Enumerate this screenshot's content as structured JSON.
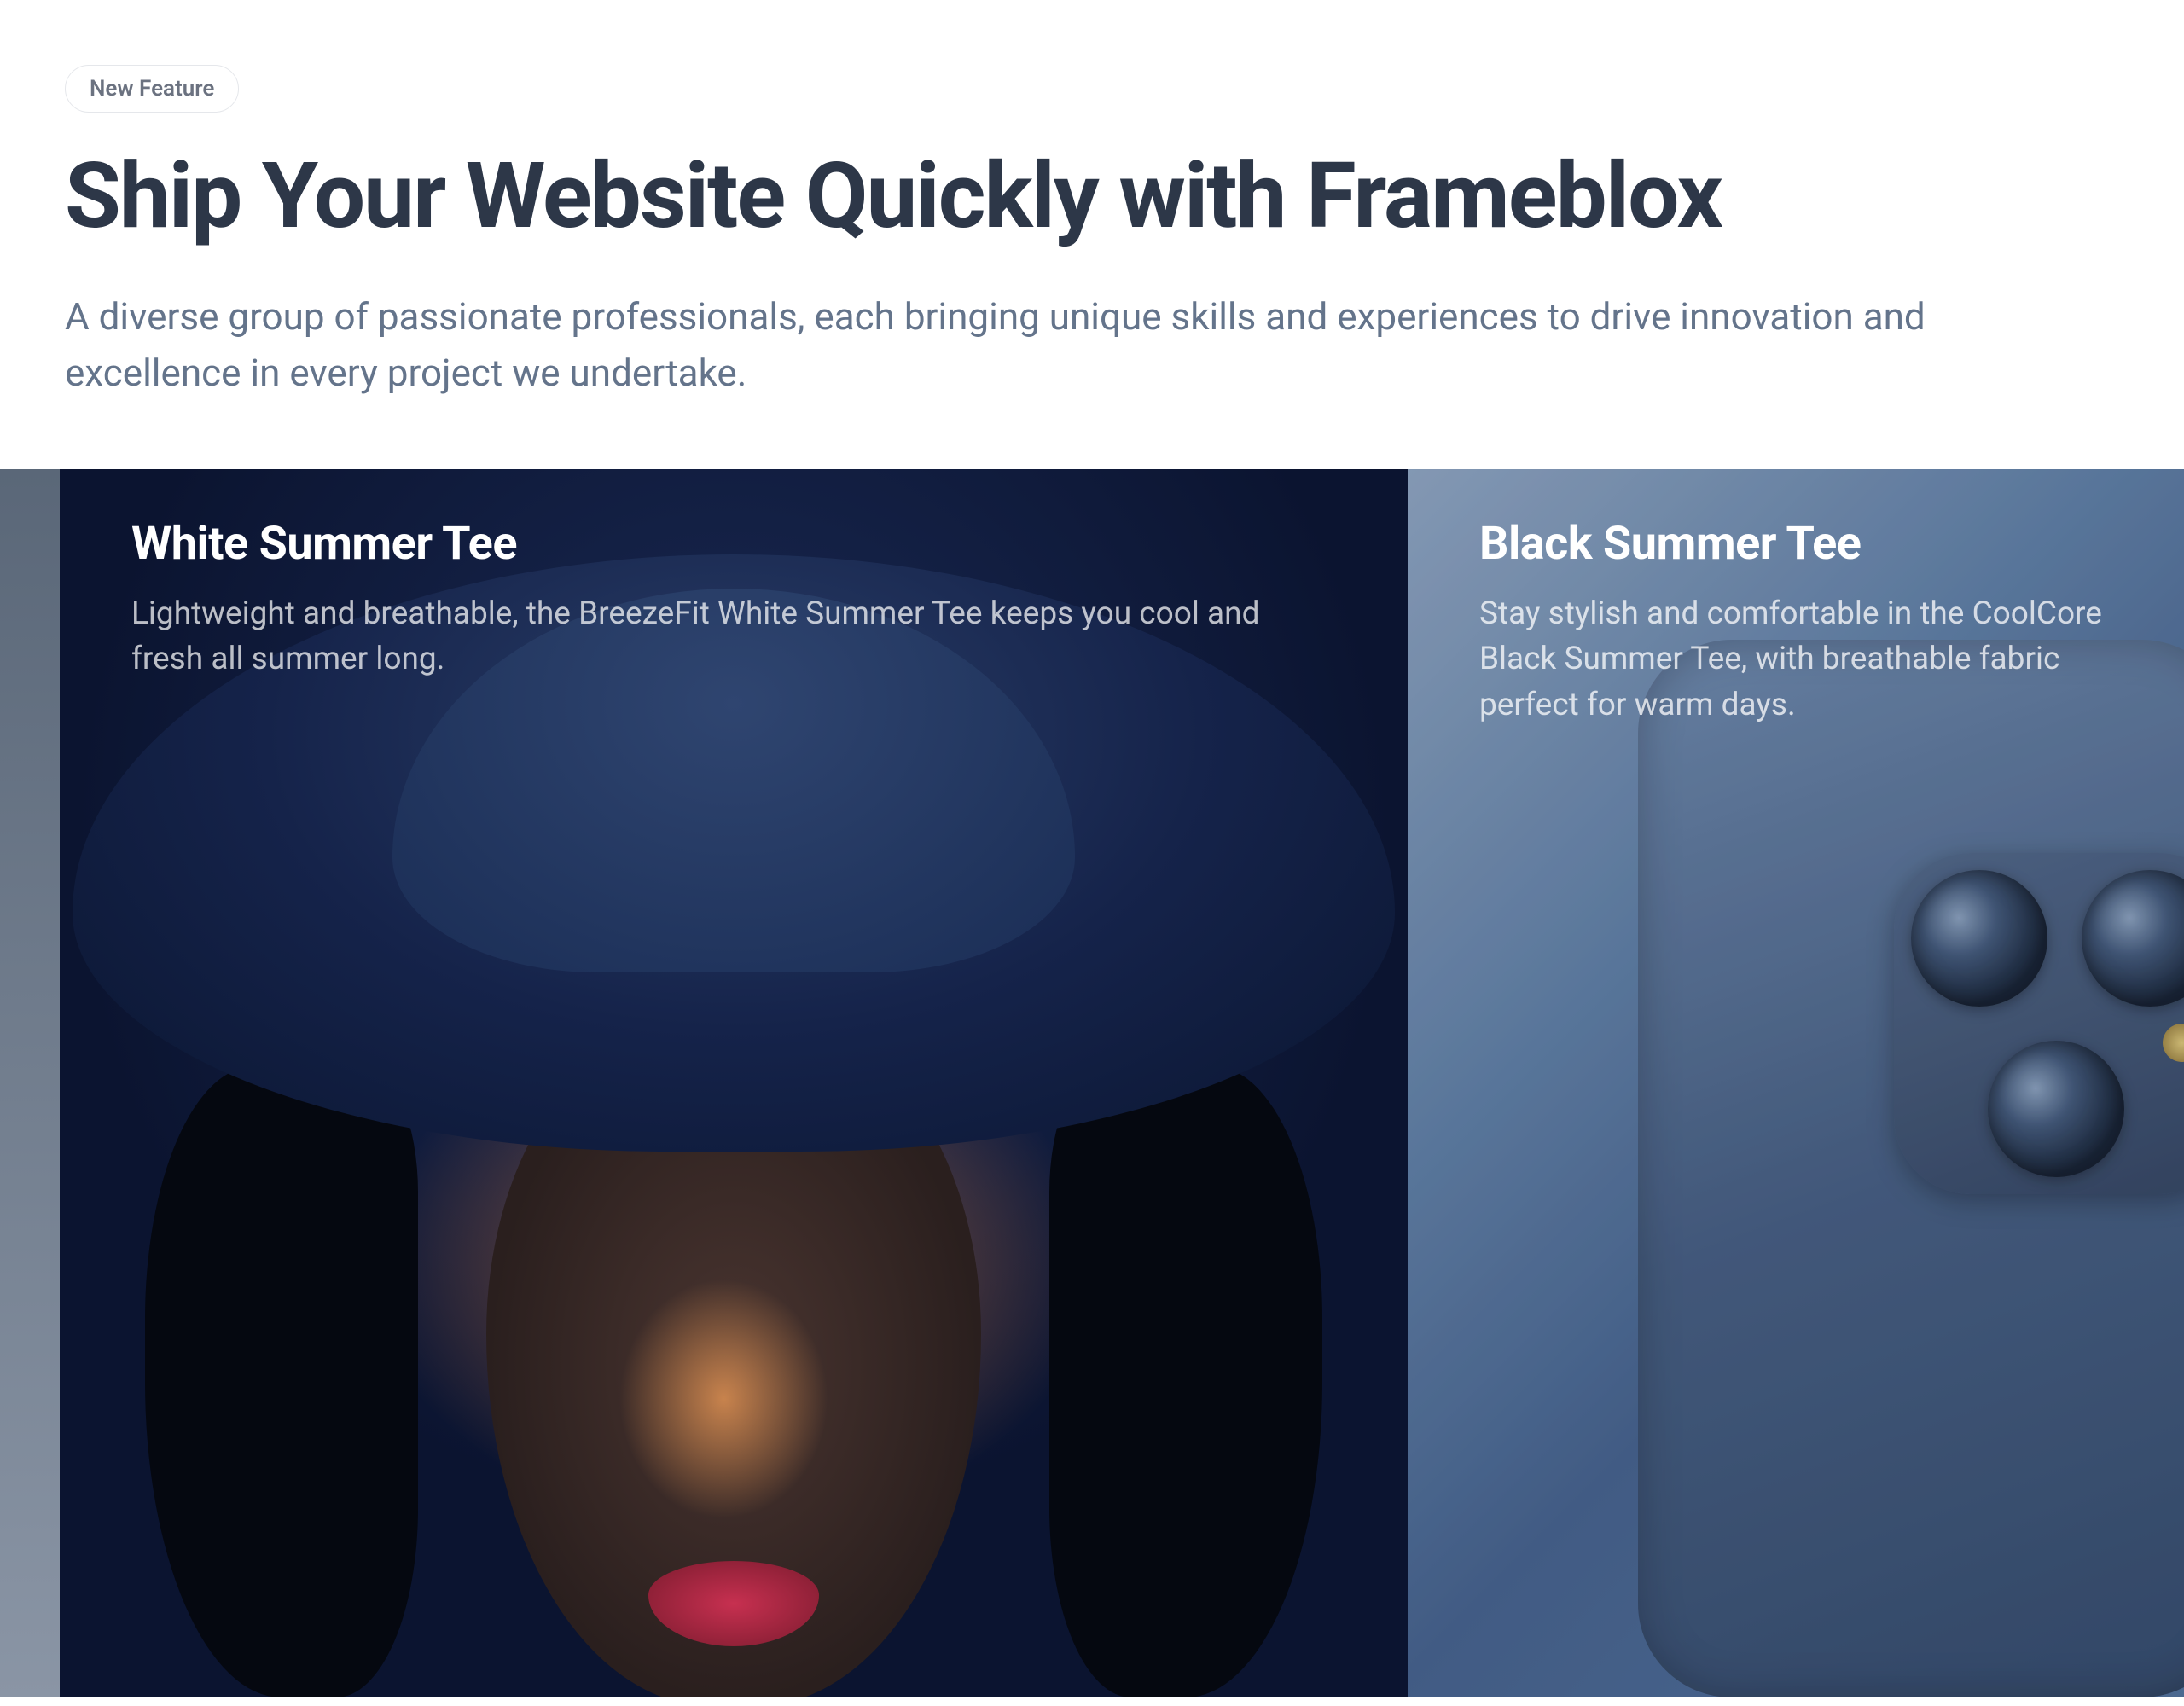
{
  "header": {
    "badge": "New Feature",
    "title": "Ship Your Website Quickly with Frameblox",
    "subtitle": "A diverse group of passionate professionals, each bringing unique skills and experiences to drive innovation and excellence in every project we undertake."
  },
  "slides": [
    {
      "title": "White Summer Tee",
      "description": "Lightweight and breathable, the BreezeFit White Summer Tee keeps you cool and fresh all summer long."
    },
    {
      "title": "Black Summer Tee",
      "description": "Stay stylish and comfortable in the CoolCore Black Summer Tee, with breathable fabric perfect for warm days."
    }
  ]
}
